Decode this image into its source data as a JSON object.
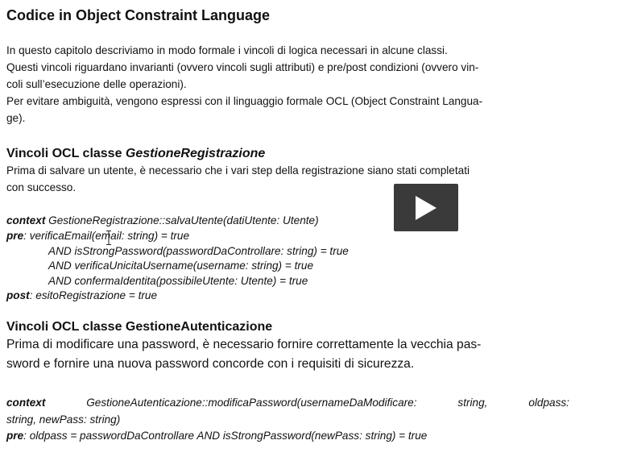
{
  "title": "Codice in Object Constraint Language",
  "intro": [
    "In questo capitolo descriviamo in modo formale i vincoli di logica necessari in alcune classi.",
    "Questi vincoli riguardano invarianti (ovvero vincoli sugli attributi) e pre/post condizioni (ovvero vin-",
    "coli sull’esecuzione delle operazioni).",
    "Per evitare ambiguità, vengono espressi con il linguaggio formale OCL (Object Constraint Langua-",
    "ge)."
  ],
  "section1": {
    "heading_prefix": "Vincoli OCL classe ",
    "heading_class": "GestioneRegistrazione",
    "desc": [
      "Prima di salvare un utente, è necessario che i vari step della registrazione siano stati completati",
      "con successo."
    ],
    "code": {
      "context_kw": "context",
      "context": "GestioneRegistrazione::salvaUtente(datiUtente: Utente)",
      "pre_kw": "pre",
      "pre": ": verificaEmail(email: string) = true",
      "and_lines": [
        "AND isStrongPassword(passwordDaControllare: string) = true",
        "AND verificaUnicitaUsername(username: string) = true",
        "AND confermaIdentita(possibileUtente: Utente) = true"
      ],
      "post_kw": "post",
      "post": ": esitoRegistrazione = true"
    }
  },
  "section2": {
    "heading": "Vincoli OCL classe GestioneAutenticazione",
    "desc": [
      "Prima di modificare una password, è necessario fornire correttamente la vecchia pas-",
      "sword e fornire una nuova password concorde con i requisiti di sicurezza."
    ],
    "code": {
      "context_kw": "context",
      "context_parts": [
        "GestioneAutenticazione::modificaPassword(usernameDaModificare:",
        "string,",
        "oldpass:"
      ],
      "context_line2": "string, newPass: string)",
      "pre_kw": "pre",
      "pre": ": oldpass = passwordDaControllare AND isStrongPassword(newPass: string) = true"
    }
  },
  "video": {
    "play_icon": "play-icon",
    "bg": "#3a3a3a"
  }
}
